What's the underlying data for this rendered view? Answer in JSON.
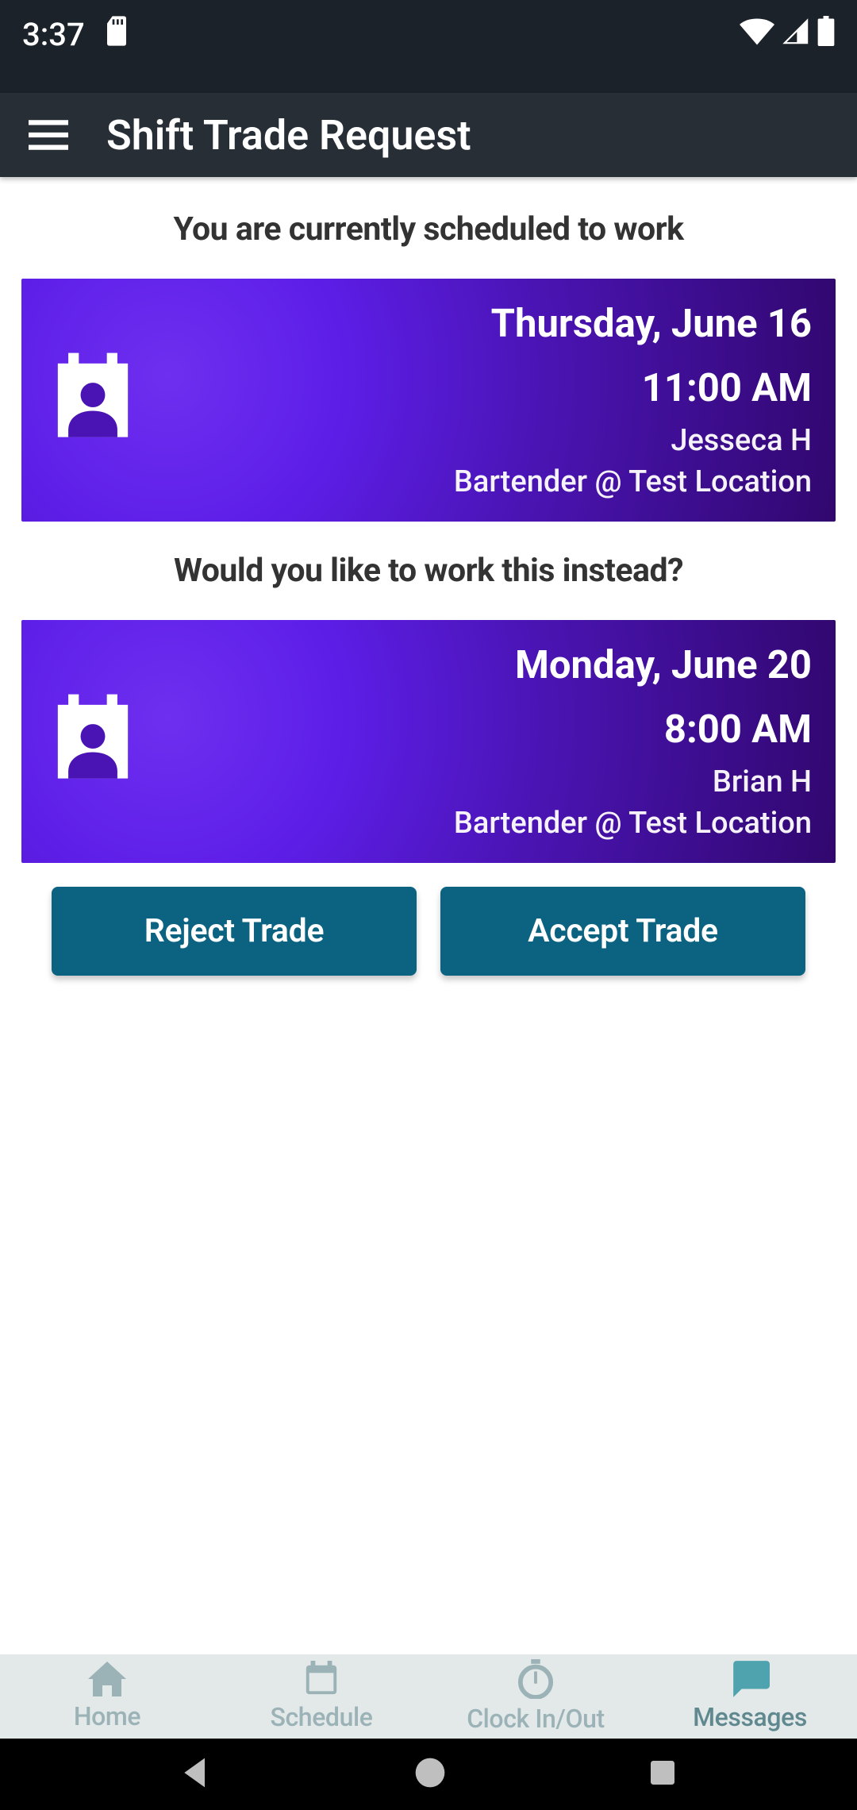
{
  "status": {
    "time": "3:37"
  },
  "toolbar": {
    "title": "Shift Trade Request"
  },
  "headings": {
    "current": "You are currently scheduled to work",
    "proposed": "Would you like to work this instead?"
  },
  "current_shift": {
    "date": "Thursday, June 16",
    "time": "11:00 AM",
    "person": "Jesseca H",
    "role": "Bartender @ Test Location"
  },
  "proposed_shift": {
    "date": "Monday, June 20",
    "time": "8:00 AM",
    "person": "Brian H",
    "role": "Bartender @ Test Location"
  },
  "actions": {
    "reject": "Reject Trade",
    "accept": "Accept Trade"
  },
  "tabs": {
    "home": "Home",
    "schedule": "Schedule",
    "clock": "Clock In/Out",
    "messages": "Messages"
  }
}
